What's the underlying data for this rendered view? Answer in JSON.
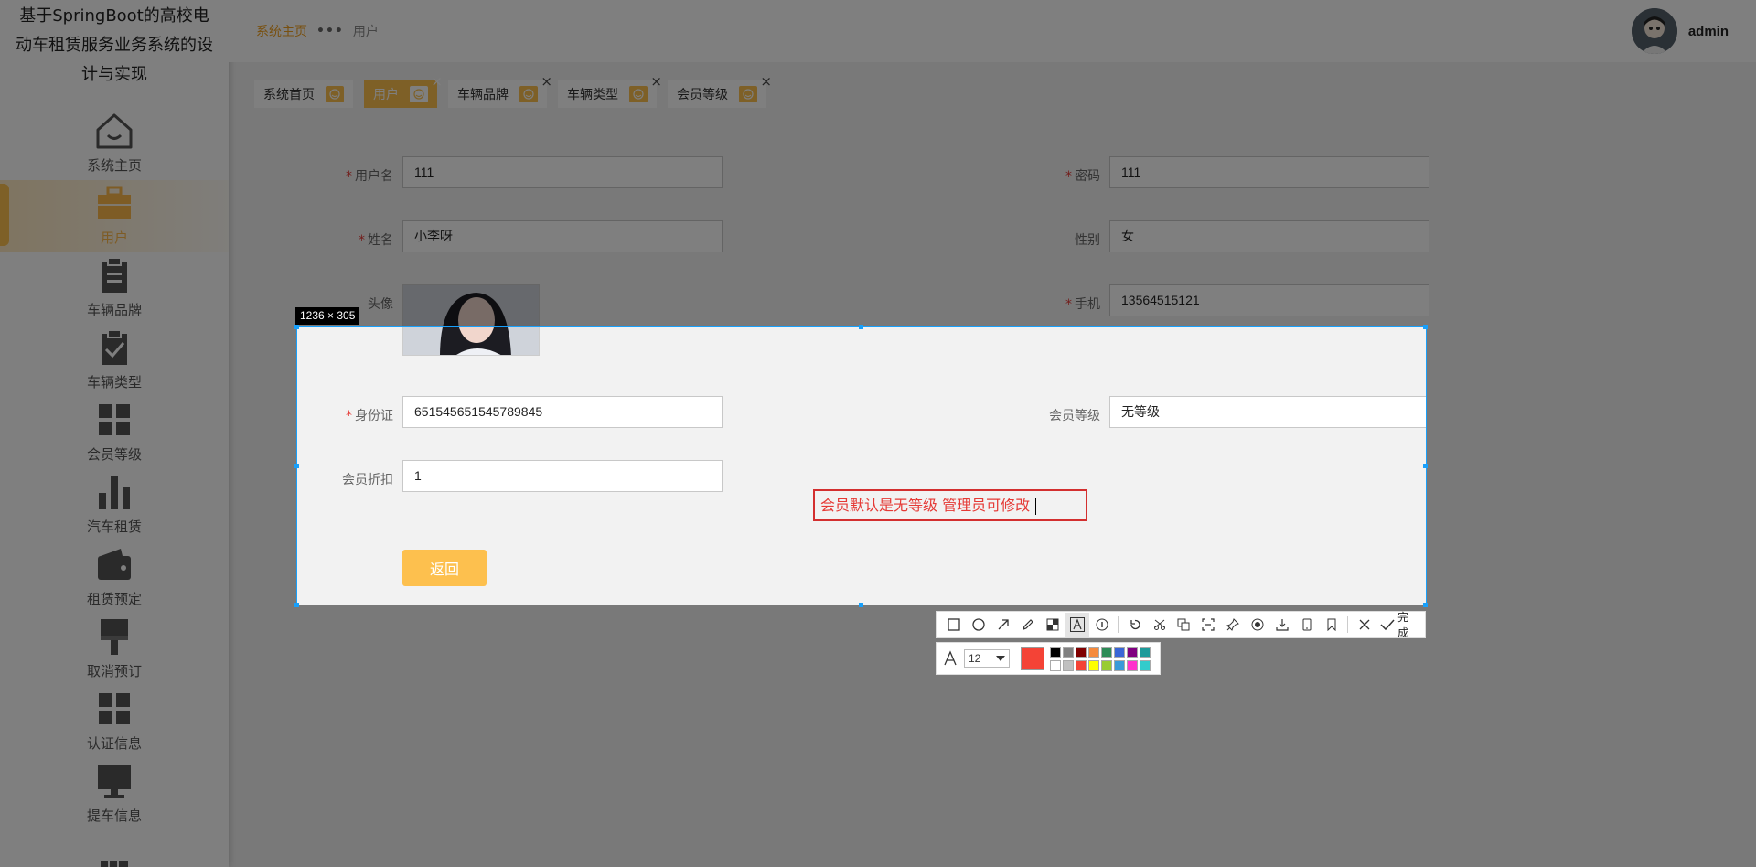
{
  "app": {
    "title": "基于SpringBoot的高校电动车租赁服务业务系统的设计与实现"
  },
  "sidebar": {
    "items": [
      {
        "label": "系统主页",
        "icon": "home-icon"
      },
      {
        "label": "用户",
        "icon": "briefcase-icon"
      },
      {
        "label": "车辆品牌",
        "icon": "clipboard-icon"
      },
      {
        "label": "车辆类型",
        "icon": "clipboard-check-icon"
      },
      {
        "label": "会员等级",
        "icon": "grid-icon"
      },
      {
        "label": "汽车租赁",
        "icon": "bar-chart-icon"
      },
      {
        "label": "租赁预定",
        "icon": "wallet-icon"
      },
      {
        "label": "取消预订",
        "icon": "brush-icon"
      },
      {
        "label": "认证信息",
        "icon": "grid-icon"
      },
      {
        "label": "提车信息",
        "icon": "monitor-icon"
      }
    ],
    "active_index": 1
  },
  "header": {
    "breadcrumb_home": "系统主页",
    "breadcrumb_sep": "•••",
    "breadcrumb_current": "用户",
    "username": "admin"
  },
  "tabs": [
    {
      "label": "系统首页",
      "closable": false
    },
    {
      "label": "用户",
      "closable": true,
      "active": true
    },
    {
      "label": "车辆品牌",
      "closable": true
    },
    {
      "label": "车辆类型",
      "closable": true
    },
    {
      "label": "会员等级",
      "closable": true
    }
  ],
  "form": {
    "username_label": "用户名",
    "username_value": "111",
    "password_label": "密码",
    "password_value": "111",
    "name_label": "姓名",
    "name_value": "小李呀",
    "gender_label": "性别",
    "gender_value": "女",
    "avatar_label": "头像",
    "phone_label": "手机",
    "phone_value": "13564515121",
    "idcard_label": "身份证",
    "idcard_value": "651545651545789845",
    "level_label": "会员等级",
    "level_value": "无等级",
    "discount_label": "会员折扣",
    "discount_value": "1",
    "back_button": "返回",
    "required_mark": "*"
  },
  "screenshot_tool": {
    "size_badge": "1236 × 305",
    "annotation_text": "会员默认是无等级  管理员可修改",
    "done_label": "完成",
    "font_size": "12",
    "current_color": "#f44336",
    "palette": [
      "#000000",
      "#808080",
      "#800000",
      "#f58a3c",
      "#2e8b57",
      "#3a66d6",
      "#800080",
      "#1e9a9a",
      "#ffffff",
      "#c0c0c0",
      "#f44336",
      "#ffff00",
      "#99cc33",
      "#3a9ad9",
      "#ff33cc",
      "#33cccc"
    ]
  },
  "colors": {
    "accent": "#fdc04e",
    "selection_border": "#18a0fb",
    "annotation": "#d32f2f"
  }
}
